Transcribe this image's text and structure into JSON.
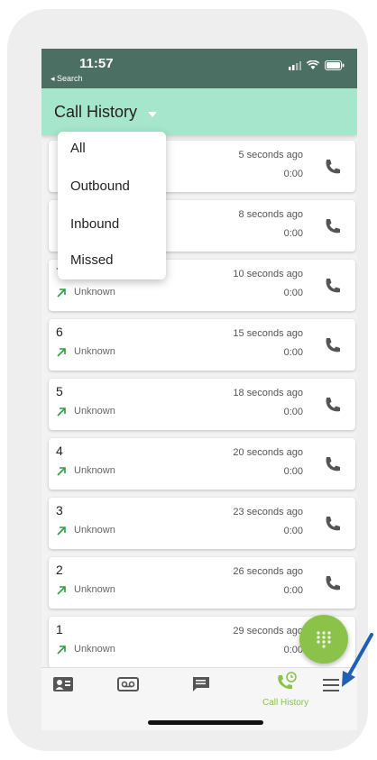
{
  "status_bar": {
    "time": "11:57",
    "back_label": "◂ Search"
  },
  "header": {
    "title": "Call History"
  },
  "filter_menu": {
    "items": [
      "All",
      "Outbound",
      "Inbound",
      "Missed"
    ]
  },
  "calls": [
    {
      "number": "",
      "direction": "",
      "time_ago": "5 seconds ago",
      "duration": "0:00"
    },
    {
      "number": "",
      "direction": "",
      "time_ago": "8 seconds ago",
      "duration": "0:00"
    },
    {
      "number": "7",
      "direction": "Unknown",
      "time_ago": "10 seconds ago",
      "duration": "0:00"
    },
    {
      "number": "6",
      "direction": "Unknown",
      "time_ago": "15 seconds ago",
      "duration": "0:00"
    },
    {
      "number": "5",
      "direction": "Unknown",
      "time_ago": "18 seconds ago",
      "duration": "0:00"
    },
    {
      "number": "4",
      "direction": "Unknown",
      "time_ago": "20 seconds ago",
      "duration": "0:00"
    },
    {
      "number": "3",
      "direction": "Unknown",
      "time_ago": "23 seconds ago",
      "duration": "0:00"
    },
    {
      "number": "2",
      "direction": "Unknown",
      "time_ago": "26 seconds ago",
      "duration": "0:00"
    },
    {
      "number": "1",
      "direction": "Unknown",
      "time_ago": "29 seconds ago",
      "duration": "0:00"
    }
  ],
  "tabbar": {
    "active_label": "Call History"
  },
  "icons": [
    "contacts-icon",
    "voicemail-icon",
    "messages-icon",
    "call-history-icon",
    "hamburger-menu-icon",
    "dialpad-icon",
    "phone-icon",
    "outbound-arrow-icon"
  ],
  "colors": {
    "header_bg": "#a6e6cc",
    "status_bar_bg": "#4c6f63",
    "accent_green": "#8bc34a",
    "outbound_arrow": "#2e9e3e",
    "pointer_arrow": "#1f5fb5"
  }
}
